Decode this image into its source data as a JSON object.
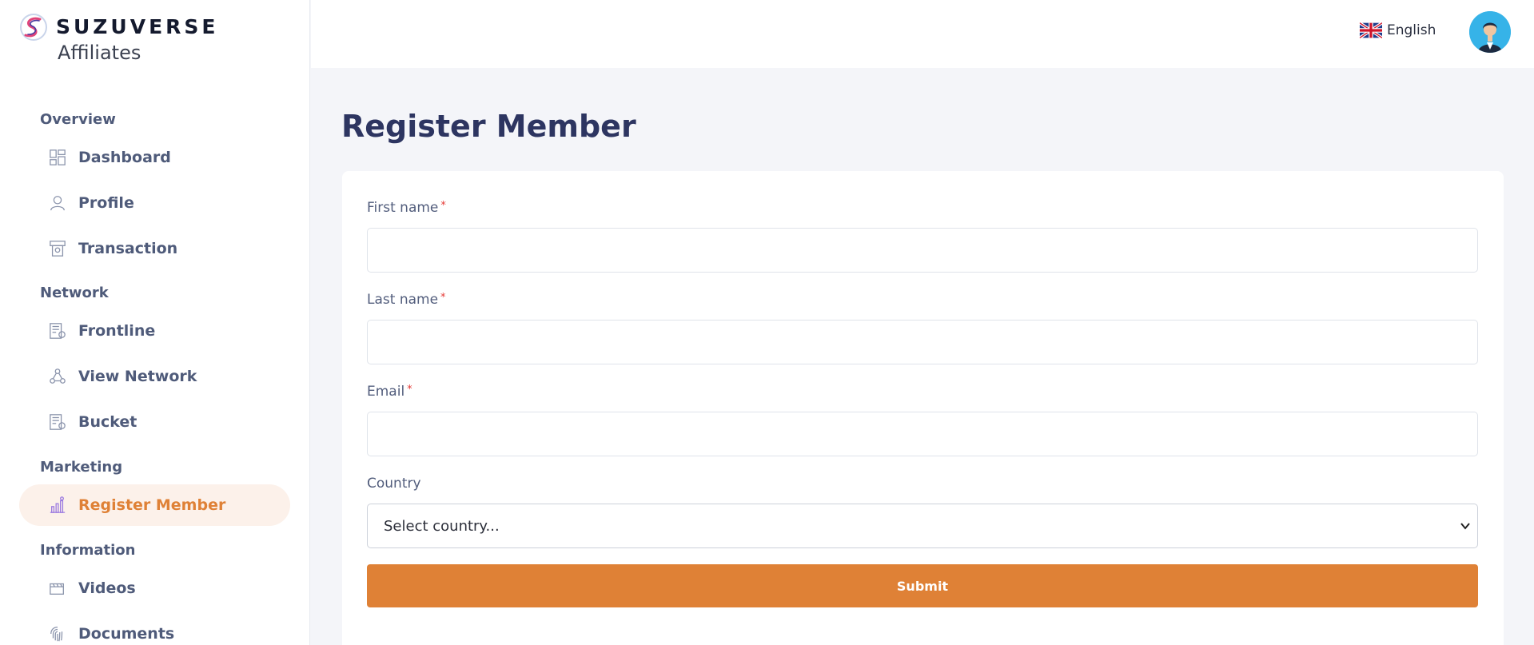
{
  "brand": {
    "name": "SUZUVERSE",
    "subtitle": "Affiliates"
  },
  "sidebar": {
    "sections": [
      {
        "title": "Overview",
        "items": [
          {
            "label": "Dashboard",
            "icon": "dashboard-icon"
          },
          {
            "label": "Profile",
            "icon": "profile-icon"
          },
          {
            "label": "Transaction",
            "icon": "transaction-icon"
          }
        ]
      },
      {
        "title": "Network",
        "items": [
          {
            "label": "Frontline",
            "icon": "frontline-icon"
          },
          {
            "label": "View Network",
            "icon": "network-icon"
          },
          {
            "label": "Bucket",
            "icon": "bucket-icon"
          }
        ]
      },
      {
        "title": "Marketing",
        "items": [
          {
            "label": "Register Member",
            "icon": "register-chart-icon",
            "active": true
          }
        ]
      },
      {
        "title": "Information",
        "items": [
          {
            "label": "Videos",
            "icon": "videos-icon"
          },
          {
            "label": "Documents",
            "icon": "fingerprint-icon"
          }
        ]
      }
    ]
  },
  "header": {
    "language": "English",
    "flag": "uk-flag-icon",
    "avatar": "user-avatar"
  },
  "main": {
    "title": "Register Member",
    "form": {
      "first_name_label": "First name",
      "last_name_label": "Last name",
      "email_label": "Email",
      "required_mark": "*",
      "country_label": "Country",
      "country_placeholder": "Select country...",
      "submit_label": "Submit",
      "first_name_value": "",
      "last_name_value": "",
      "email_value": ""
    }
  },
  "colors": {
    "accent": "#df8136",
    "active_bg": "#fcf1ea",
    "title": "#2d3561",
    "page_bg": "#f4f5f9"
  }
}
